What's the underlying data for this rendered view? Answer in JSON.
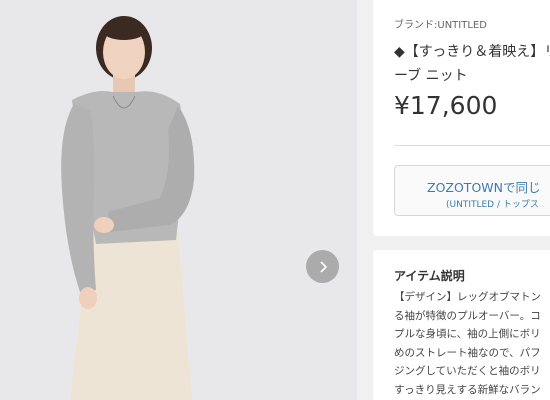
{
  "product": {
    "brand_label": "ブランド:UNTITLED",
    "title": "◆【すっきり＆着映え】リーブ ニット",
    "price": "¥17,600"
  },
  "store_button": {
    "label": "ZOZOTOWNで同じ",
    "sublabel": "(UNTITLED / トップス"
  },
  "description": {
    "heading": "アイテム説明",
    "lines": [
      "【デザイン】レッグオブマトン",
      "る袖が特徴のプルオーバー。コ",
      "プルな身頃に、袖の上側にボリ",
      "めのストレート袖なので、パフ",
      "ジングしていただくと袖のボリ",
      "すっきり見えする新鮮なバラン"
    ]
  },
  "gallery": {
    "next_icon": "chevron-right-icon"
  }
}
